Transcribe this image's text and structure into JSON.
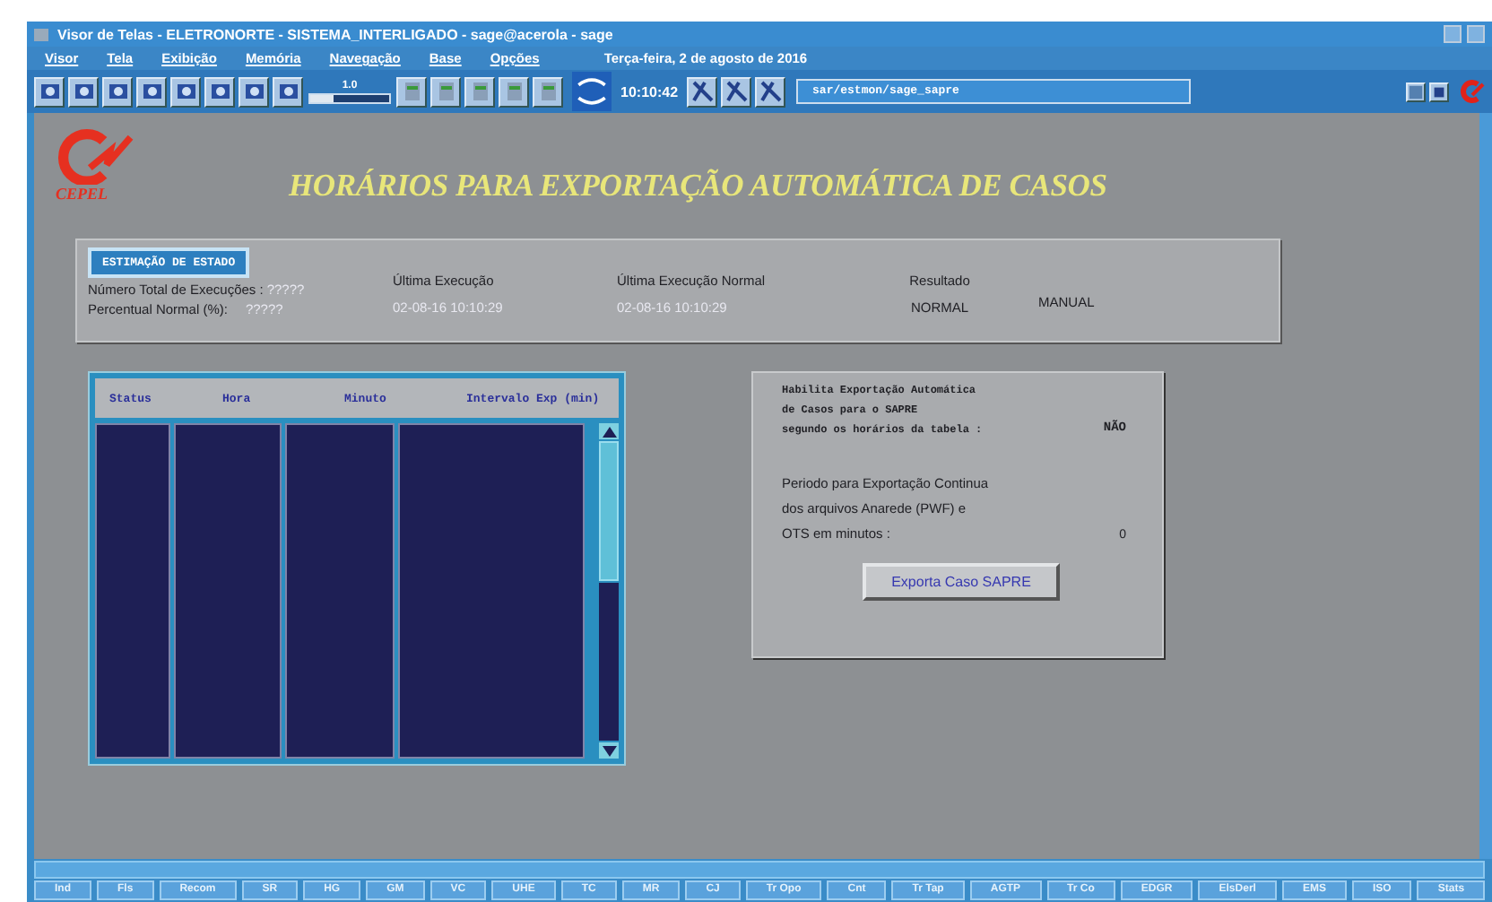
{
  "window": {
    "title": "Visor de Telas - ELETRONORTE - SISTEMA_INTERLIGADO  - sage@acerola - sage"
  },
  "menu": [
    "Visor",
    "Tela",
    "Exibição",
    "Memória",
    "Navegação",
    "Base",
    "Opções"
  ],
  "menu_date": "Terça-feira, 2 de agosto de 2016",
  "toolbar": {
    "zoom": {
      "label": "1.0",
      "level": 0.3
    },
    "clock": "10:10:42",
    "path": "sar/estmon/sage_sapre"
  },
  "header": {
    "logo_text": "CEPEL",
    "title": "HORÁRIOS PARA EXPORTAÇÃO AUTOMÁTICA DE CASOS"
  },
  "estimation": {
    "button": "ESTIMAÇÃO DE ESTADO",
    "labels": [
      "Número Total de Execuções :",
      "Percentual Normal (%):"
    ],
    "values": [
      "?????",
      "?????"
    ],
    "columns": [
      {
        "heading": "Última Execução",
        "value": "02-08-16 10:10:29"
      },
      {
        "heading": "Última Execução Normal",
        "value": "02-08-16 10:10:29"
      },
      {
        "heading": "Resultado",
        "value": "NORMAL"
      }
    ],
    "mode": "MANUAL"
  },
  "table": {
    "columns": [
      "Status",
      "Hora",
      "Minuto",
      "Intervalo Exp (min)"
    ]
  },
  "export_panel": {
    "auto_lines": [
      "Habilita Exportação Automática",
      "de Casos para o SAPRE",
      "segundo os horários da tabela :"
    ],
    "auto_value": "NÃO",
    "period_lines": [
      "Periodo para Exportação Continua",
      "dos arquivos Anarede (PWF) e",
      "OTS em minutos :"
    ],
    "period_value": "0",
    "button": "Exporta Caso SAPRE"
  },
  "bottom_buttons": [
    "Ind",
    "Fls",
    "Recom",
    "SR",
    "HG",
    "GM",
    "VC",
    "UHE",
    "TC",
    "MR",
    "CJ",
    "Tr Opo",
    "Cnt",
    "Tr Tap",
    "AGTP",
    "Tr Co",
    "EDGR",
    "ElsDerl",
    "EMS",
    "ISO",
    "Stats"
  ]
}
